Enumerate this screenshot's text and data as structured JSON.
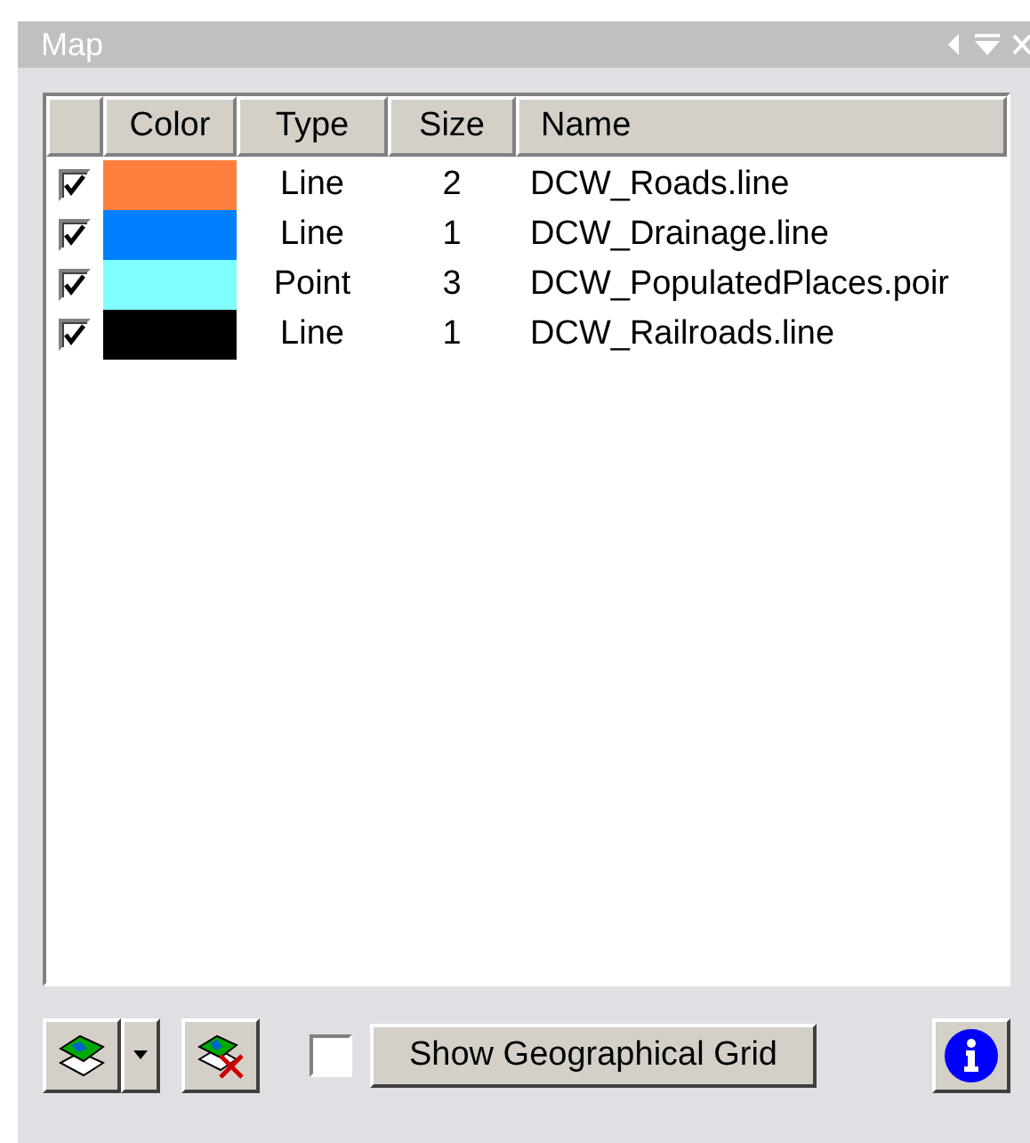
{
  "window": {
    "title": "Map"
  },
  "table": {
    "columns": [
      "Color",
      "Type",
      "Size",
      "Name"
    ],
    "rows": [
      {
        "checked": true,
        "color": "#ff7f3f",
        "type": "Line",
        "size": "2",
        "name": "DCW_Roads.line"
      },
      {
        "checked": true,
        "color": "#0080ff",
        "type": "Line",
        "size": "1",
        "name": "DCW_Drainage.line"
      },
      {
        "checked": true,
        "color": "#80ffff",
        "type": "Point",
        "size": "3",
        "name": "DCW_PopulatedPlaces.poir"
      },
      {
        "checked": true,
        "color": "#000000",
        "type": "Line",
        "size": "1",
        "name": "DCW_Railroads.line"
      }
    ]
  },
  "grid": {
    "checked": false,
    "label": "Show Geographical Grid"
  }
}
